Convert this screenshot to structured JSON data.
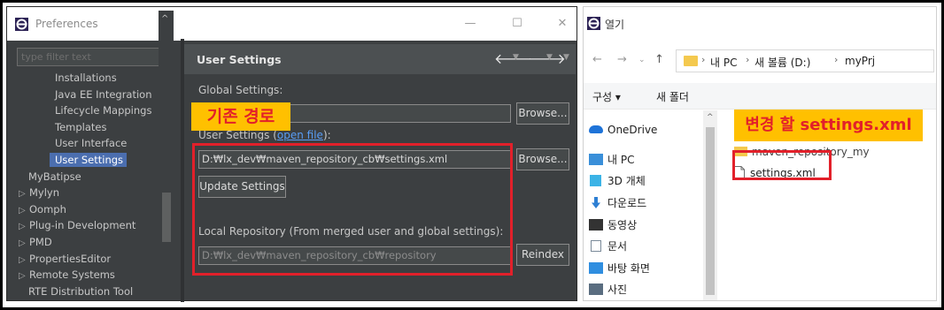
{
  "prefs": {
    "title": "Preferences",
    "win_min": "—",
    "win_max": "☐",
    "win_close": "✕",
    "filter_placeholder": "type filter text",
    "tree": [
      {
        "label": "Installations",
        "indent": 2,
        "arrow": ""
      },
      {
        "label": "Java EE Integration",
        "indent": 2,
        "arrow": ""
      },
      {
        "label": "Lifecycle Mappings",
        "indent": 2,
        "arrow": ""
      },
      {
        "label": "Templates",
        "indent": 2,
        "arrow": ""
      },
      {
        "label": "User Interface",
        "indent": 2,
        "arrow": ""
      },
      {
        "label": "User Settings",
        "indent": 2,
        "arrow": "",
        "selected": true
      },
      {
        "label": "MyBatipse",
        "indent": 1,
        "arrow": ""
      },
      {
        "label": "Mylyn",
        "indent": 0,
        "arrow": "▷"
      },
      {
        "label": "Oomph",
        "indent": 0,
        "arrow": "▷"
      },
      {
        "label": "Plug-in Development",
        "indent": 0,
        "arrow": "▷"
      },
      {
        "label": "PMD",
        "indent": 0,
        "arrow": "▷"
      },
      {
        "label": "PropertiesEditor",
        "indent": 0,
        "arrow": "▷"
      },
      {
        "label": "Remote Systems",
        "indent": 0,
        "arrow": "▷"
      },
      {
        "label": "RTE Distribution Tool",
        "indent": 1,
        "arrow": ""
      }
    ],
    "page_title": "User Settings",
    "global_settings_label": "Global Settings:",
    "global_settings_value": "",
    "user_settings_label_prefix": "User Settings (",
    "user_settings_link": "open file",
    "user_settings_label_suffix": "):",
    "user_settings_value": "D:₩lx_dev₩maven_repository_cb₩settings.xml",
    "browse_label": "Browse...",
    "update_settings_label": "Update Settings",
    "local_repo_label": "Local Repository (From merged user and global settings):",
    "local_repo_value": "D:₩lx_dev₩maven_repository_cb₩repository",
    "reindex_label": "Reindex",
    "callout": "기존 경로"
  },
  "open_dialog": {
    "title": "열기",
    "breadcrumbs": [
      "내 PC",
      "새 볼륨 (D:)",
      "myPrj"
    ],
    "organize_label": "구성 ▾",
    "new_folder_label": "새 폴더",
    "nav_items": [
      {
        "label": "OneDrive",
        "icon": "cloud-icon",
        "color": "#1e73d8"
      },
      {
        "label": "내 PC",
        "icon": "computer-icon",
        "color": "#3a8fd9"
      },
      {
        "label": "3D 개체",
        "icon": "cube-icon",
        "color": "#3bb3e6"
      },
      {
        "label": "다운로드",
        "icon": "download-icon",
        "color": "#2d7fd3"
      },
      {
        "label": "동영상",
        "icon": "film-icon",
        "color": "#333333"
      },
      {
        "label": "문서",
        "icon": "document-icon",
        "color": "#7a8a99"
      },
      {
        "label": "바탕 화면",
        "icon": "desktop-icon",
        "color": "#2f8ee0"
      },
      {
        "label": "사진",
        "icon": "picture-icon",
        "color": "#5a6d80"
      }
    ],
    "files": [
      {
        "label": "maven_repository_my",
        "icon": "folder-icon"
      },
      {
        "label": "settings.xml",
        "icon": "file-icon"
      }
    ],
    "callout": "변경 할 settings.xml"
  }
}
